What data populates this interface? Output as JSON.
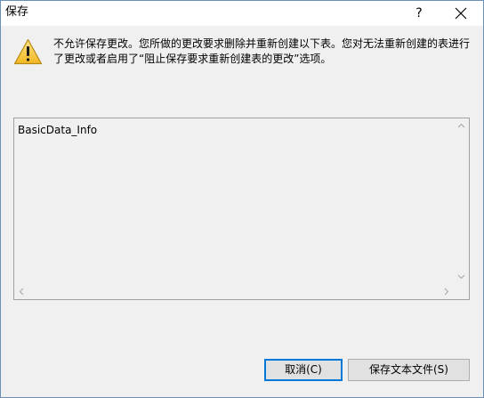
{
  "dialog": {
    "title": "保存",
    "help_label": "?",
    "close_icon": "close-icon",
    "message": "不允许保存更改。您所做的更改要求删除并重新创建以下表。您对无法重新创建的表进行了更改或者启用了“阻止保存要求重新创建表的更改”选项。",
    "warning_icon": "warning-icon",
    "tables": [
      "BasicData_Info"
    ],
    "buttons": {
      "cancel": "取消(C)",
      "save_text_file": "保存文本文件(S)"
    }
  },
  "colors": {
    "accent": "#0078d7",
    "warning_fill": "#f7c948",
    "dialog_background": "#f0f0f0"
  }
}
